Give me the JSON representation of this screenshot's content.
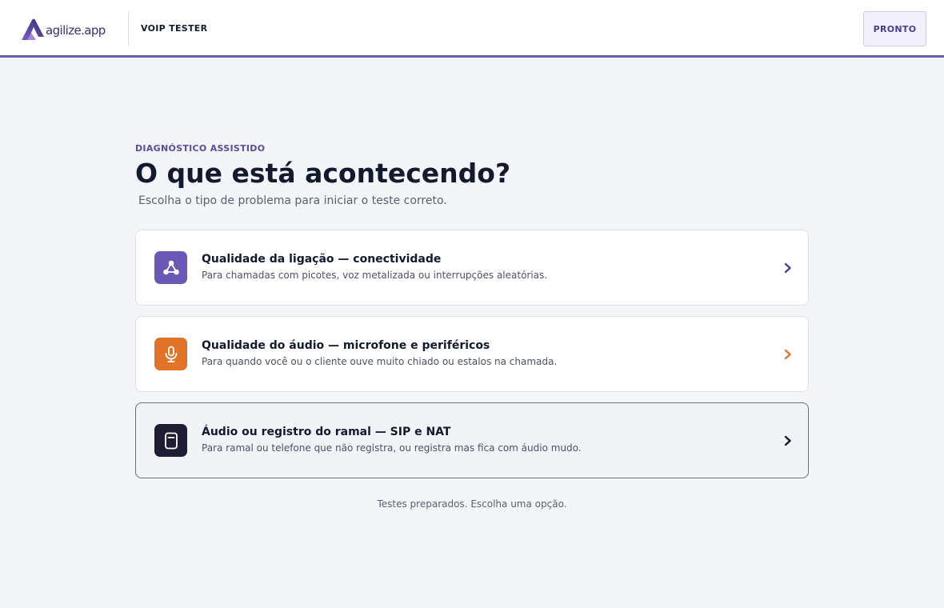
{
  "header": {
    "logo_text": "agilize.app",
    "app_title": "VOIP TESTER",
    "status_label": "PRONTO"
  },
  "main": {
    "eyebrow": "DIAGNÓSTICO ASSISTIDO",
    "headline": "O que está acontecendo?",
    "subhead": "Escolha o tipo de problema para iniciar o teste correto.",
    "options": [
      {
        "title": "Qualidade da ligação — conectividade",
        "description": "Para chamadas com picotes, voz metalizada ou interrupções aleatórias.",
        "icon": "network-icon",
        "icon_color": "#6b57b5",
        "chevron_color": "#4b3e8f",
        "selected": false
      },
      {
        "title": "Qualidade do áudio — microfone e periféricos",
        "description": "Para quando você ou o cliente ouve muito chiado ou estalos na chamada.",
        "icon": "microphone-icon",
        "icon_color": "#e2742a",
        "chevron_color": "#e2742a",
        "selected": false
      },
      {
        "title": "Áudio ou registro do ramal — SIP e NAT",
        "description": "Para ramal ou telefone que não registra, ou registra mas fica com áudio mudo.",
        "icon": "phone-device-icon",
        "icon_color": "#1f1d33",
        "chevron_color": "#141a2e",
        "selected": true
      }
    ],
    "footer_note": "Testes preparados. Escolha uma opção."
  },
  "colors": {
    "accent": "#6a5ba8",
    "background": "#f4f5f8"
  }
}
